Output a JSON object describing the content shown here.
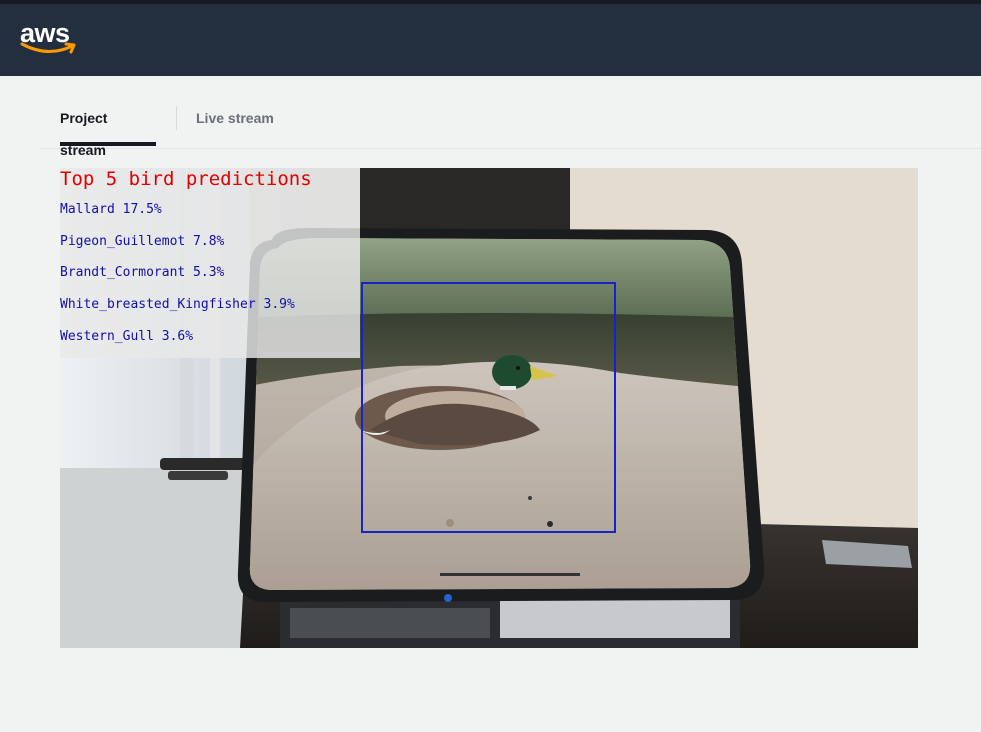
{
  "header": {
    "logo_text": "aws",
    "brand_color": "#232f3e",
    "logo_accent": "#ff9900"
  },
  "tabs": [
    {
      "label": "Project stream",
      "active": true
    },
    {
      "label": "Live stream",
      "active": false
    }
  ],
  "video": {
    "overlay": {
      "title": "Top 5 bird predictions",
      "title_color": "#e10000",
      "prediction_color": "#1010a8",
      "predictions": [
        {
          "label": "Mallard 17.5%"
        },
        {
          "label": "Pigeon_Guillemot 7.8%"
        },
        {
          "label": "Brandt_Cormorant 5.3%"
        },
        {
          "label": "White_breasted_Kingfisher 3.9%"
        },
        {
          "label": "Western_Gull 3.6%"
        }
      ]
    },
    "bounding_box_color": "#1424c8"
  }
}
